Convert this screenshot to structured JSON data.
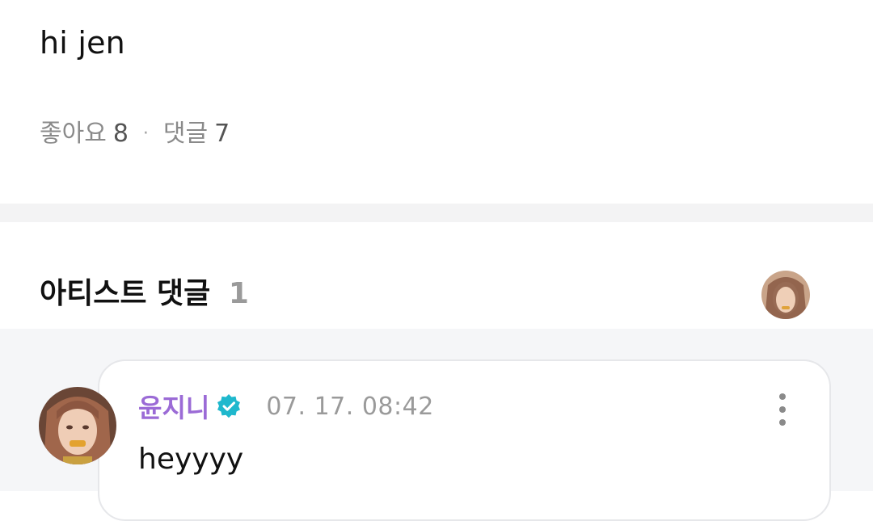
{
  "post": {
    "body": "hi jen",
    "likes_label": "좋아요",
    "likes_count": "8",
    "separator": "·",
    "comments_label": "댓글",
    "comments_count": "7"
  },
  "artist_comments": {
    "title": "아티스트 댓글",
    "count": "1"
  },
  "comments": [
    {
      "author": "윤지니",
      "verified": true,
      "timestamp": "07. 17. 08:42",
      "text": "heyyyy"
    }
  ],
  "colors": {
    "author_name": "#9b6bd6",
    "verified_badge": "#1fb8cd",
    "muted_text": "#8a8a8a",
    "divider": "#f3f3f4",
    "comments_bg": "#f5f6f8"
  },
  "icons": {
    "verified": "verified-badge-icon",
    "more": "more-vertical-icon"
  }
}
